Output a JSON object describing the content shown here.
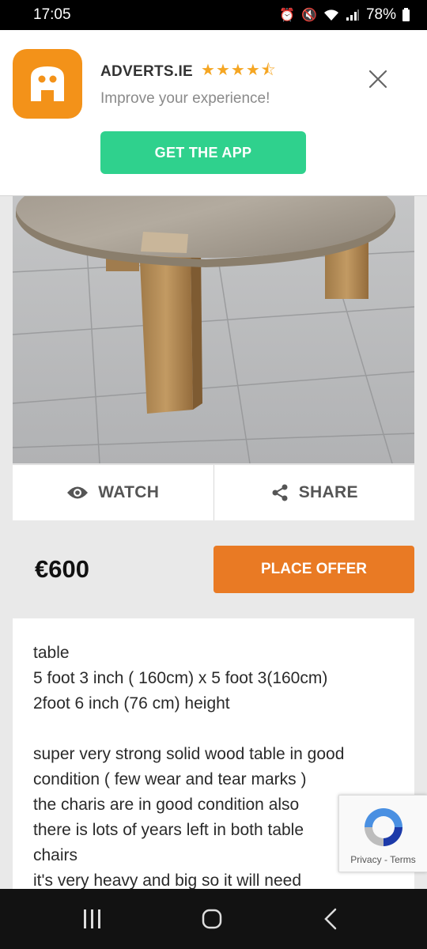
{
  "status_bar": {
    "time": "17:05",
    "battery": "78%",
    "icons": [
      "alarm-icon",
      "mute-icon",
      "wifi-icon",
      "call-icon",
      "signal-icon",
      "battery-icon"
    ]
  },
  "app_banner": {
    "name": "ADVERTS.IE",
    "rating": 4.5,
    "stars_display": "★★★★⯪",
    "tagline": "Improve your experience!",
    "cta_label": "GET THE APP",
    "close_icon": "close-icon"
  },
  "listing": {
    "photo_subject": "round wooden table on tiled floor",
    "watch_label": "WATCH",
    "share_label": "SHARE",
    "price": "€600",
    "offer_label": "PLACE OFFER",
    "description_lines": [
      "table",
      "5 foot 3 inch ( 160cm) x 5 foot 3(160cm)",
      "2foot 6 inch (76 cm) height",
      "",
      "super very strong solid wood table in good",
      "condition ( few wear and tear marks )",
      "the charis are in good condition also",
      "there is lots of years left in both table",
      "chairs",
      "it's very heavy and big so it will need"
    ]
  },
  "recaptcha": {
    "privacy": "Privacy",
    "separator": "-",
    "terms": "Terms"
  },
  "colors": {
    "brand_orange": "#f39219",
    "cta_green": "#2fd18d",
    "offer_orange": "#e97a24",
    "star_gold": "#f5a623"
  }
}
